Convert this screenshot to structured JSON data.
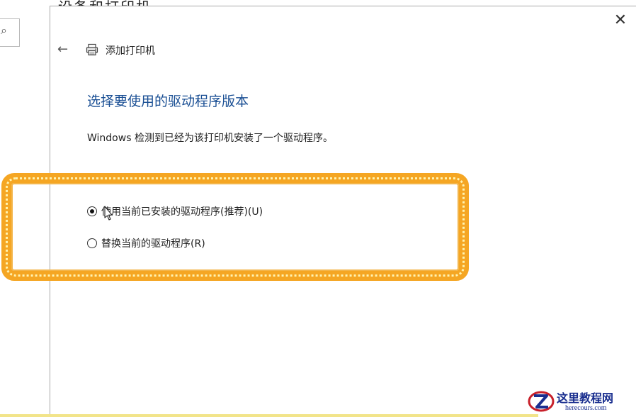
{
  "background_window": {
    "search_icon": "search-icon",
    "title_fragment": "设备和打印机"
  },
  "dialog": {
    "close_icon": "close-icon",
    "back_icon": "back-arrow-icon",
    "printer_icon": "printer-icon",
    "title": "添加打印机",
    "heading": "选择要使用的驱动程序版本",
    "description": "Windows 检测到已经为该打印机安装了一个驱动程序。",
    "options": [
      {
        "label": "使用当前已安装的驱动程序(推荐)(U)",
        "selected": true
      },
      {
        "label": "替换当前的驱动程序(R)",
        "selected": false
      }
    ]
  },
  "annotation": {
    "highlight_color": "#f5a623"
  },
  "watermark": {
    "name_cn": "这里教程网",
    "url": "herecours.com"
  },
  "colors": {
    "heading": "#1a4f94",
    "text": "#222222",
    "border": "#a8a8a8"
  }
}
